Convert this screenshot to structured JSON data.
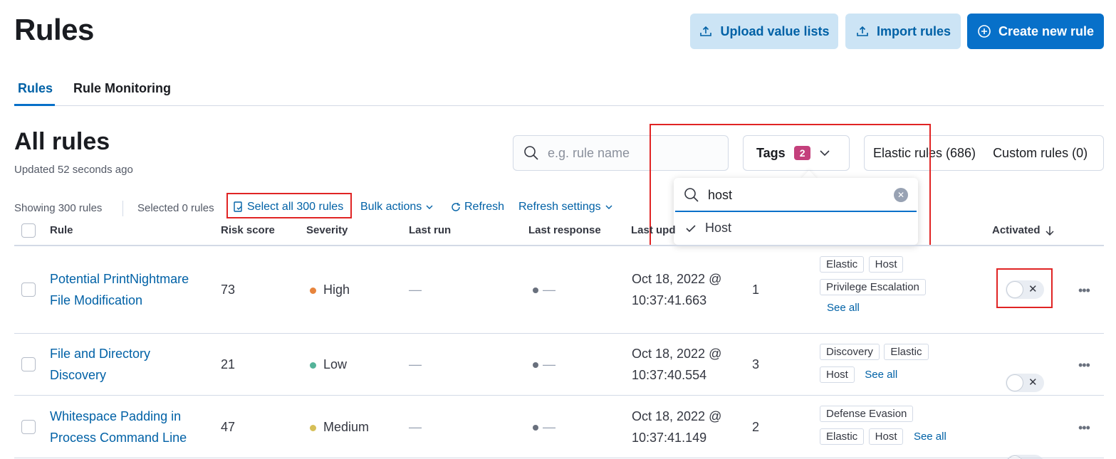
{
  "header": {
    "title": "Rules",
    "upload_label": "Upload value lists",
    "import_label": "Import rules",
    "create_label": "Create new rule"
  },
  "tabs": [
    {
      "label": "Rules",
      "active": true
    },
    {
      "label": "Rule Monitoring",
      "active": false
    }
  ],
  "section": {
    "title": "All rules",
    "updated": "Updated 52 seconds ago"
  },
  "filters": {
    "search_placeholder": "e.g. rule name",
    "tags_label": "Tags",
    "tags_count": "2",
    "elastic_rules": "Elastic rules (686)",
    "custom_rules": "Custom rules (0)"
  },
  "tags_popover": {
    "search_value": "host",
    "option": "Host"
  },
  "toolbar": {
    "showing": "Showing 300 rules",
    "selected": "Selected 0 rules",
    "select_all": "Select all 300 rules",
    "bulk_actions": "Bulk actions",
    "refresh": "Refresh",
    "refresh_settings": "Refresh settings"
  },
  "columns": {
    "rule": "Rule",
    "risk_score": "Risk score",
    "severity": "Severity",
    "last_run": "Last run",
    "last_response": "Last response",
    "last_updated": "Last upd",
    "activated": "Activated"
  },
  "rows": [
    {
      "name_line1": "Potential PrintNightmare",
      "name_line2": "File Modification",
      "risk_score": "73",
      "severity": "High",
      "severity_color": "#e7843c",
      "last_run": "—",
      "last_response": "—",
      "updated_line1": "Oct 18, 2022 @",
      "updated_line2": "10:37:41.663",
      "version": "1",
      "tags": [
        "Elastic",
        "Host",
        "Privilege Escalation"
      ],
      "see_all": "See all"
    },
    {
      "name_line1": "File and Directory",
      "name_line2": "Discovery",
      "risk_score": "21",
      "severity": "Low",
      "severity_color": "#54b399",
      "last_run": "—",
      "last_response": "—",
      "updated_line1": "Oct 18, 2022 @",
      "updated_line2": "10:37:40.554",
      "version": "3",
      "tags": [
        "Discovery",
        "Elastic",
        "Host"
      ],
      "see_all": "See all"
    },
    {
      "name_line1": "Whitespace Padding in",
      "name_line2": "Process Command Line",
      "risk_score": "47",
      "severity": "Medium",
      "severity_color": "#d6bf57",
      "last_run": "—",
      "last_response": "—",
      "updated_line1": "Oct 18, 2022 @",
      "updated_line2": "10:37:41.149",
      "version": "2",
      "tags": [
        "Defense Evasion",
        "Elastic",
        "Host"
      ],
      "see_all": "See all"
    }
  ],
  "colors": {
    "accent": "#0770c9",
    "link": "#0061a6",
    "highlight_box": "#e02424",
    "tags_badge": "#c4407c"
  }
}
